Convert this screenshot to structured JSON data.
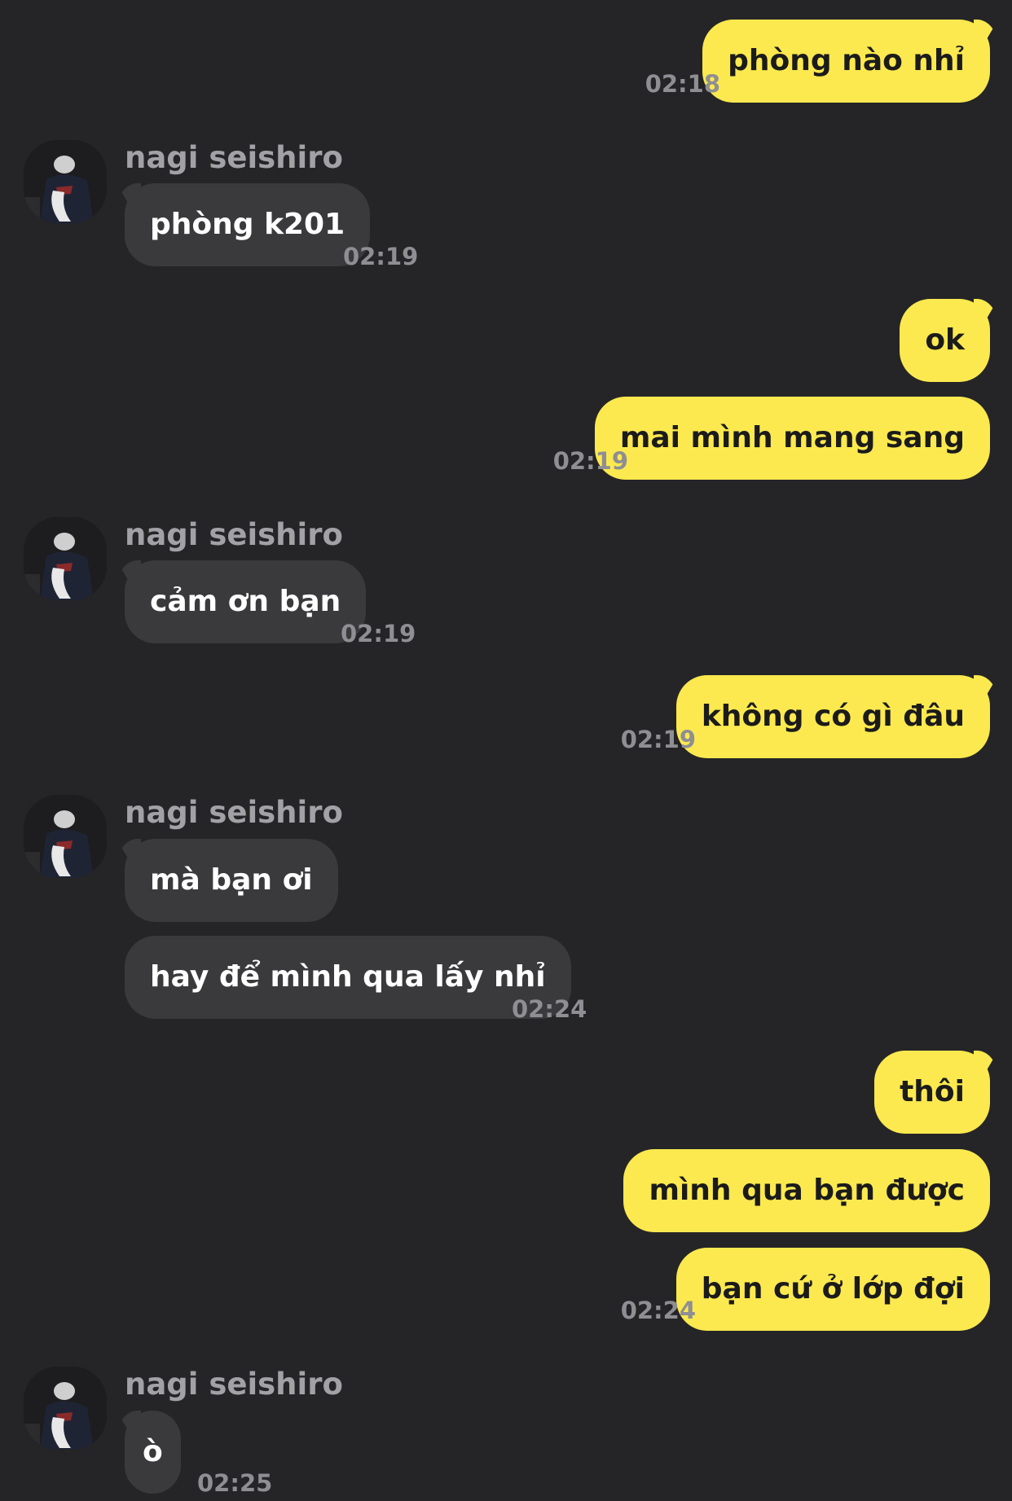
{
  "contact": {
    "name": "nagi seishiro"
  },
  "messages": {
    "m1": {
      "text": "phòng nào nhỉ",
      "time": "02:18"
    },
    "m2": {
      "text": "phòng k201",
      "time": "02:19"
    },
    "m3": {
      "text": "ok"
    },
    "m4": {
      "text": "mai mình mang sang",
      "time": "02:19"
    },
    "m5": {
      "text": "cảm ơn bạn",
      "time": "02:19"
    },
    "m6": {
      "text": "không có gì đâu",
      "time": "02:19"
    },
    "m7": {
      "text": "mà bạn ơi"
    },
    "m8": {
      "text": "hay để mình qua lấy nhỉ",
      "time": "02:24"
    },
    "m9": {
      "text": "thôi"
    },
    "m10": {
      "text": "mình qua bạn được"
    },
    "m11": {
      "text": "bạn cứ ở lớp đợi",
      "time": "02:24"
    },
    "m12": {
      "text": "ò",
      "time": "02:25"
    }
  },
  "colors": {
    "background": "#252527",
    "outgoing_bubble": "#fce94f",
    "incoming_bubble": "#3a3a3c",
    "timestamp": "#8e8e93",
    "sender_name": "#a2a2a6"
  },
  "icons": {
    "avatar": "contact-avatar-photo"
  }
}
